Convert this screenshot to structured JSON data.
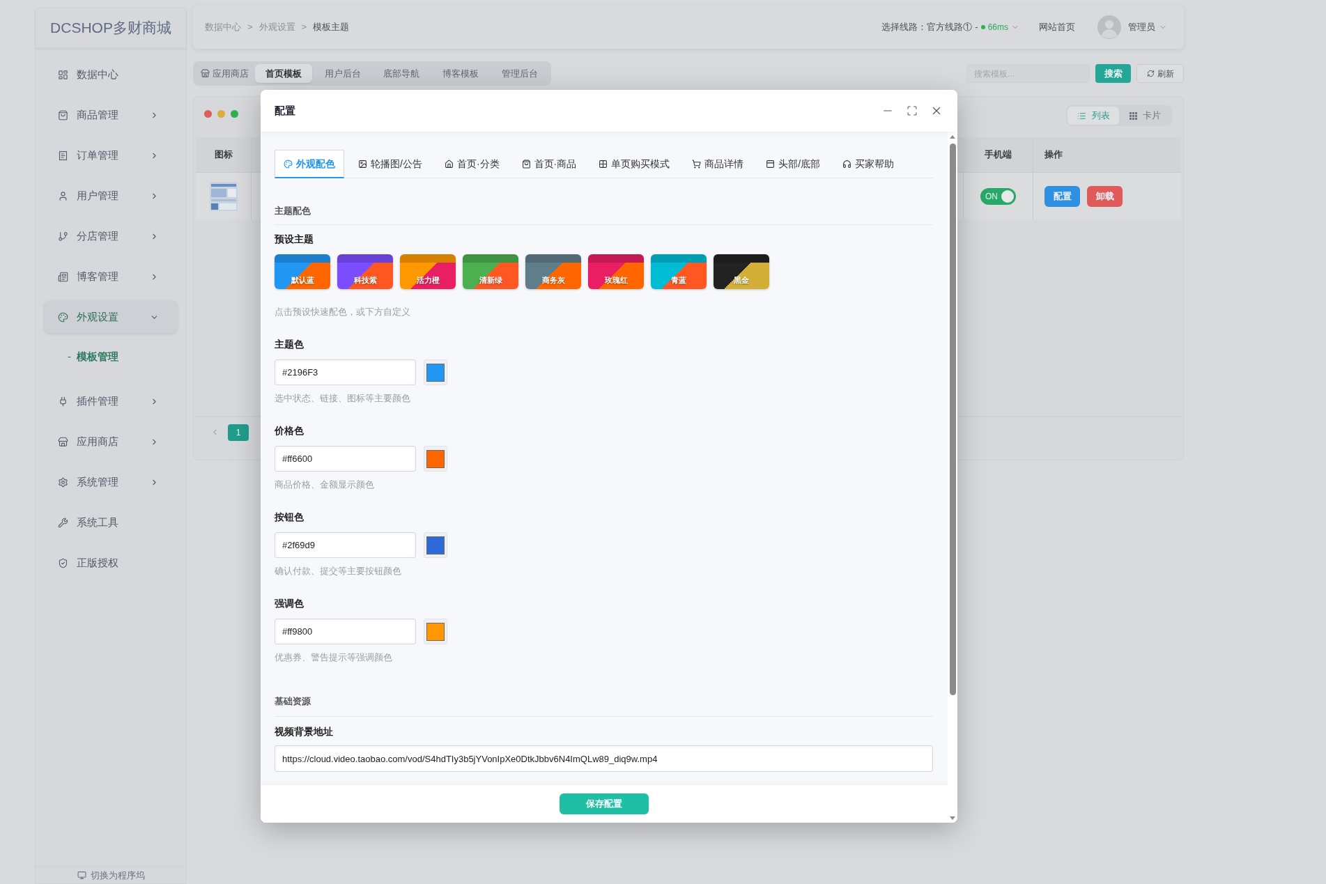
{
  "sidebar": {
    "logo": "DCSHOP多财商城",
    "items": [
      {
        "label": "数据中心",
        "kind": "link",
        "selected": false
      },
      {
        "label": "商品管理",
        "kind": "group",
        "expanded": false,
        "selected": false
      },
      {
        "label": "订单管理",
        "kind": "group",
        "expanded": false,
        "selected": false
      },
      {
        "label": "用户管理",
        "kind": "group",
        "expanded": false,
        "selected": false
      },
      {
        "label": "分店管理",
        "kind": "group",
        "expanded": false,
        "selected": false
      },
      {
        "label": "博客管理",
        "kind": "group",
        "expanded": false,
        "selected": false
      },
      {
        "label": "外观设置",
        "kind": "group",
        "expanded": true,
        "selected": true,
        "children": [
          {
            "prefix": "-",
            "label": "模板管理",
            "selected": true
          }
        ]
      },
      {
        "label": "插件管理",
        "kind": "group",
        "expanded": false,
        "selected": false
      },
      {
        "label": "应用商店",
        "kind": "group",
        "expanded": false,
        "selected": false
      },
      {
        "label": "系统管理",
        "kind": "group",
        "expanded": false,
        "selected": false
      },
      {
        "label": "系统工具",
        "kind": "link",
        "selected": false
      },
      {
        "label": "正版授权",
        "kind": "link",
        "selected": false
      }
    ],
    "footer": "切换为程序坞"
  },
  "header": {
    "breadcrumb": [
      "数据中心",
      "外观设置",
      "模板主题"
    ],
    "separator": ">",
    "line_label": "选择线路：官方线路①",
    "line_separator": "-",
    "latency": "66ms",
    "home_link": "网站首页",
    "user": "管理员"
  },
  "template_tabs": [
    {
      "label": "应用商店",
      "kind": "store",
      "selected": false
    },
    {
      "label": "首页模板",
      "kind": "tab",
      "selected": true
    },
    {
      "label": "用户后台",
      "kind": "tab",
      "selected": false
    },
    {
      "label": "底部导航",
      "kind": "tab",
      "selected": false
    },
    {
      "label": "博客模板",
      "kind": "tab",
      "selected": false
    },
    {
      "label": "管理后台",
      "kind": "tab",
      "selected": false
    }
  ],
  "search": {
    "placeholder": "搜索模板...",
    "button": "搜索"
  },
  "refresh_button": "刷新",
  "view_toggle": [
    {
      "label": "列表",
      "selected": true
    },
    {
      "label": "卡片",
      "selected": false
    }
  ],
  "table": {
    "columns": [
      "图标",
      "手机端",
      "操作"
    ],
    "rows": [
      {
        "mobile": {
          "label": "ON",
          "on": true
        },
        "actions": [
          "配置",
          "卸载"
        ]
      }
    ]
  },
  "pagination": {
    "current": "1"
  },
  "modal": {
    "title": "配置",
    "tabs": [
      {
        "label": "外观配色",
        "selected": true
      },
      {
        "label": "轮播图/公告",
        "selected": false
      },
      {
        "label": "首页·分类",
        "selected": false
      },
      {
        "label": "首页·商品",
        "selected": false
      },
      {
        "label": "单页购买模式",
        "selected": false
      },
      {
        "label": "商品详情",
        "selected": false
      },
      {
        "label": "头部/底部",
        "selected": false
      },
      {
        "label": "买家帮助",
        "selected": false
      }
    ],
    "sections": [
      {
        "title": "主题配色",
        "presets": {
          "label": "预设主题",
          "items": [
            {
              "label": "默认蓝",
              "fills": [
                {
                  "color": "#2196f3"
                },
                {
                  "color": "#ff6600"
                }
              ]
            },
            {
              "label": "科技紫",
              "fills": [
                {
                  "color": "#7c4dff"
                },
                {
                  "color": "#ff5722"
                }
              ]
            },
            {
              "label": "活力橙",
              "fills": [
                {
                  "color": "#ff9800"
                },
                {
                  "color": "#e91e63"
                }
              ]
            },
            {
              "label": "清新绿",
              "fills": [
                {
                  "color": "#4caf50"
                },
                {
                  "color": "#ff5722"
                }
              ]
            },
            {
              "label": "商务灰",
              "fills": [
                {
                  "color": "#607d8b"
                },
                {
                  "color": "#ff6600"
                }
              ]
            },
            {
              "label": "玫瑰红",
              "fills": [
                {
                  "color": "#e91e63"
                },
                {
                  "color": "#ff6600"
                }
              ]
            },
            {
              "label": "青蓝",
              "fills": [
                {
                  "color": "#00bcd4"
                },
                {
                  "color": "#ff5722"
                }
              ]
            },
            {
              "label": "黑金",
              "fills": [
                {
                  "color": "#222222"
                },
                {
                  "color": "#d4af37"
                }
              ]
            }
          ],
          "hint": "点击预设快速配色，或下方自定义"
        },
        "fields": [
          {
            "kind": "color",
            "label": "主题色",
            "value": "#2196F3",
            "color": "#2196f3",
            "hint": "选中状态、链接、图标等主要颜色"
          },
          {
            "kind": "color",
            "label": "价格色",
            "value": "#ff6600",
            "color": "#ff6600",
            "hint": "商品价格、金额显示颜色"
          },
          {
            "kind": "color",
            "label": "按钮色",
            "value": "#2f69d9",
            "color": "#2f69d9",
            "hint": "确认付款、提交等主要按钮颜色"
          },
          {
            "kind": "color",
            "label": "强调色",
            "value": "#ff9800",
            "color": "#ff9800",
            "hint": "优惠券、警告提示等强调颜色"
          }
        ]
      },
      {
        "title": "基础资源",
        "fields": [
          {
            "kind": "text",
            "label": "视频背景地址",
            "value": "https://cloud.video.taobao.com/vod/S4hdTIy3b5jYVonIpXe0DtkJbbv6N4ImQLw89_diq9w.mp4"
          }
        ]
      }
    ],
    "save_button": "保存配置"
  }
}
